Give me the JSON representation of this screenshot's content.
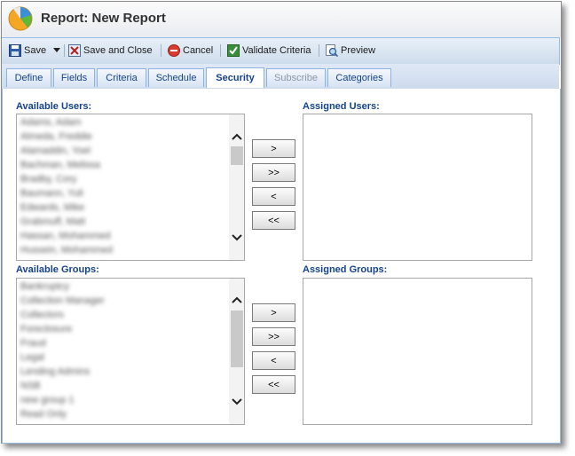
{
  "window": {
    "title": "Report: New Report"
  },
  "toolbar": {
    "save_label": "Save",
    "save_close_label": "Save and Close",
    "cancel_label": "Cancel",
    "validate_label": "Validate Criteria",
    "preview_label": "Preview"
  },
  "tabs": [
    {
      "label": "Define"
    },
    {
      "label": "Fields"
    },
    {
      "label": "Criteria"
    },
    {
      "label": "Schedule"
    },
    {
      "label": "Security",
      "active": true
    },
    {
      "label": "Subscribe",
      "disabled": true
    },
    {
      "label": "Categories"
    }
  ],
  "users": {
    "available_label": "Available Users:",
    "assigned_label": "Assigned Users:",
    "available_items": [
      "Adams, Adam",
      "Almeda, Freddie",
      "Alamaddin, Yoel",
      "Bachman, Melissa",
      "Bradby, Cory",
      "Baumann, Yuli",
      "Edwards, Mike",
      "Grabmuff, Matt",
      "Hassan, Mohammed",
      "Hussein, Mohammed"
    ],
    "move_buttons": [
      ">",
      ">>",
      "<",
      "<<"
    ]
  },
  "groups": {
    "available_label": "Available Groups:",
    "assigned_label": "Assigned Groups:",
    "available_items": [
      "Bankruptcy",
      "Collection Manager",
      "Collectors",
      "Foreclosure",
      "Fraud",
      "Legal",
      "Lending Admins",
      "NSB",
      "new group 1",
      "Read Only"
    ],
    "move_buttons": [
      ">",
      ">>",
      "<",
      "<<"
    ]
  },
  "colors": {
    "accent": "#15428b",
    "toolbar_bg": "#d4e1f2",
    "border": "#99bbe8"
  }
}
